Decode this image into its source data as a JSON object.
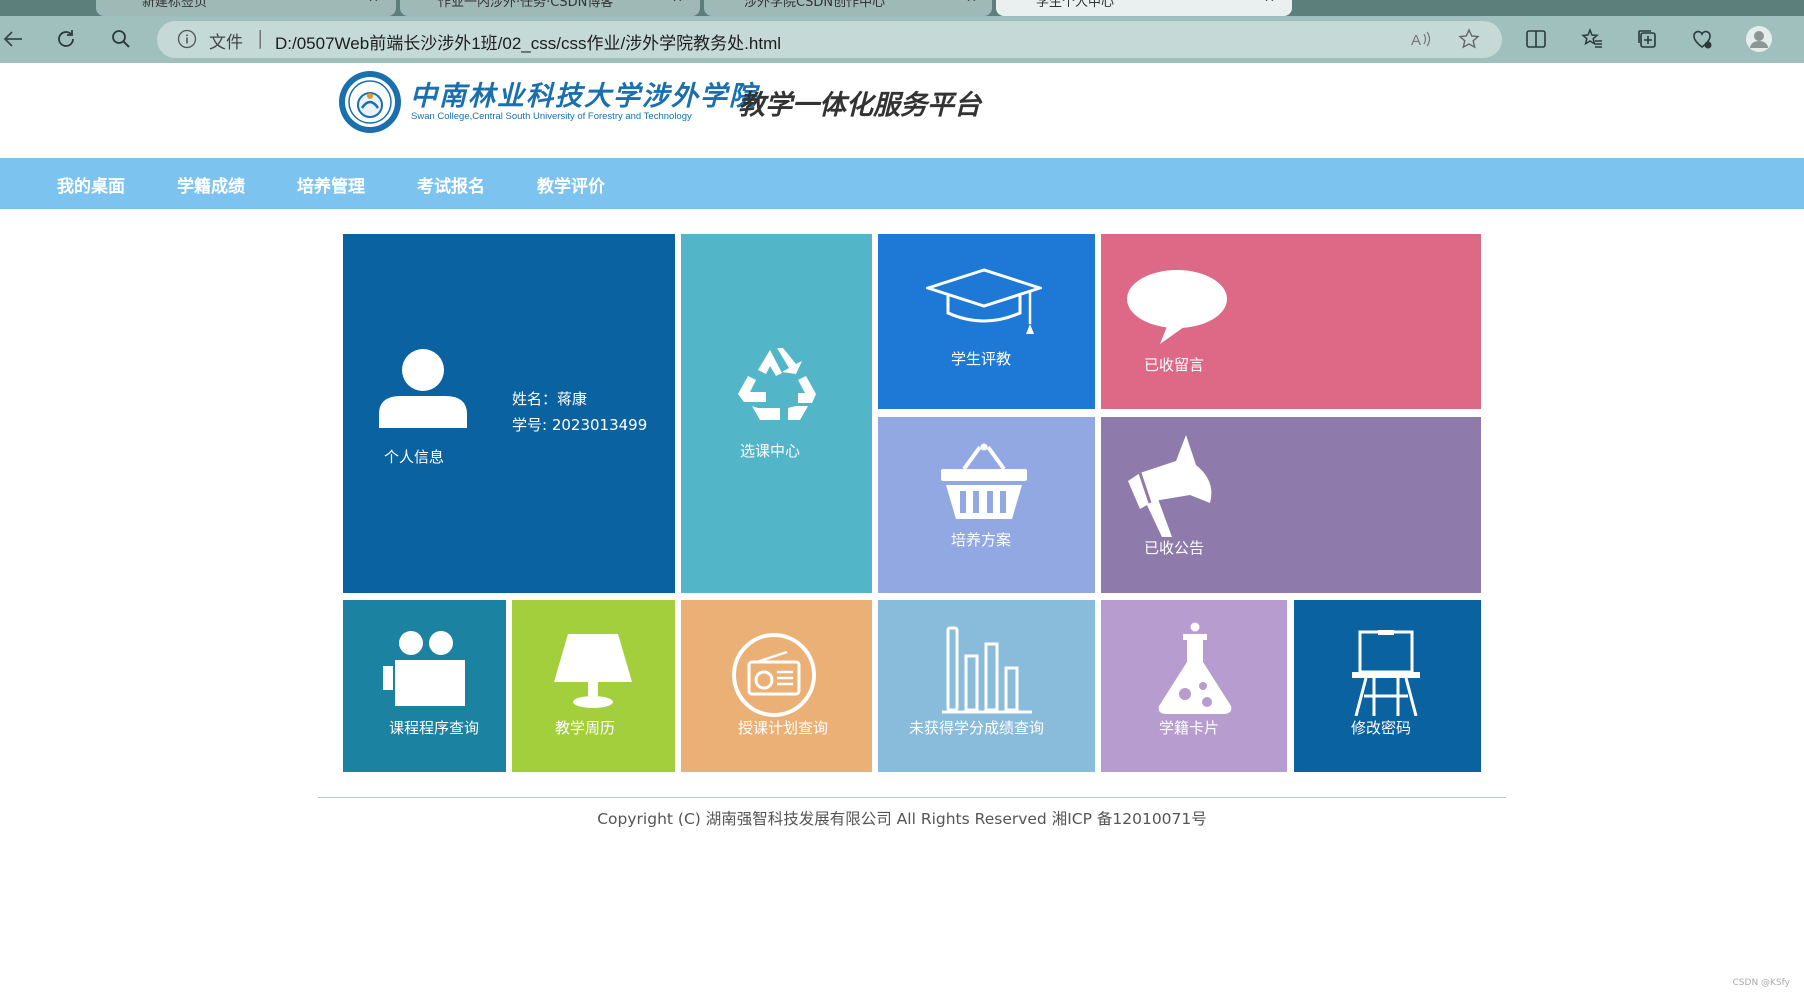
{
  "browser": {
    "tabs": [
      {
        "title": "新建标签页"
      },
      {
        "title": "作业一内涉外·任务·CSDN博客"
      },
      {
        "title": "涉外学院CSDN创作中心"
      },
      {
        "title": "学生个人中心"
      }
    ],
    "address": {
      "file_label": "文件",
      "url": "D:/0507Web前端长沙涉外1班/02_css/css作业/涉外学院教务处.html"
    }
  },
  "header": {
    "school_name": "中南林业科技大学涉外学院",
    "school_name_en": "Swan College,Central South University of Forestry and Technology",
    "platform_title": "教学一体化服务平台"
  },
  "nav": {
    "items": [
      "我的桌面",
      "学籍成绩",
      "培养管理",
      "考试报名",
      "教学评价"
    ]
  },
  "profile": {
    "label": "个人信息",
    "name_line": "姓名：蒋康",
    "id_line": "学号: 2023013499"
  },
  "tiles": {
    "course_select": "选课中心",
    "student_eval": "学生评教",
    "messages": "已收留言",
    "training_plan": "培养方案",
    "notices": "已收公告",
    "schedule_query": "课程程序查询",
    "calendar": "教学周历",
    "teaching_plan": "授课计划查询",
    "credits_query": "未获得学分成绩查询",
    "student_card": "学籍卡片",
    "change_password": "修改密码"
  },
  "colors": {
    "nav": "#7dc3ef",
    "profile": "#0b62a0",
    "course_select": "#52b5c8",
    "student_eval": "#1d79d5",
    "messages": "#dd6987",
    "training_plan": "#92a8e3",
    "notices": "#8e7aab",
    "schedule_query": "#1b82a1",
    "calendar": "#a3cf3d",
    "teaching_plan": "#ebb075",
    "credits_query": "#89bbda",
    "student_card": "#b79ccf",
    "change_password": "#0b62a0"
  },
  "footer": {
    "copyright": "Copyright (C) 湖南强智科技发展有限公司 All Rights Reserved 湘ICP 备12010071号"
  },
  "watermark": "CSDN @KSfy"
}
